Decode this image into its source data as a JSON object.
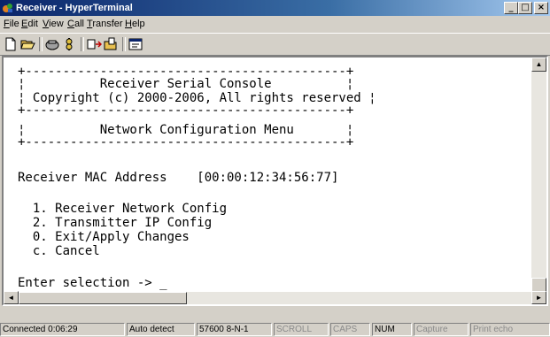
{
  "window": {
    "title": "Receiver - HyperTerminal"
  },
  "menu": {
    "items": [
      {
        "ul": "F",
        "rest": "ile"
      },
      {
        "ul": "E",
        "rest": "dit"
      },
      {
        "ul": "V",
        "rest": "iew"
      },
      {
        "ul": "C",
        "rest": "all"
      },
      {
        "ul": "T",
        "rest": "ransfer"
      },
      {
        "ul": "H",
        "rest": "elp"
      }
    ]
  },
  "toolbar": {
    "buttons": [
      "new-icon",
      "open-icon",
      "disconnect-icon",
      "connect-icon",
      "send-icon",
      "receive-icon",
      "properties-icon"
    ]
  },
  "terminal": {
    "lines": [
      "+-------------------------------------------+",
      "¦          Receiver Serial Console          ¦",
      "¦ Copyright (c) 2000-2006, All rights reserved ¦",
      "+-------------------------------------------+",
      "¦          Network Configuration Menu       ¦",
      "+-------------------------------------------+",
      "",
      "Receiver MAC Address    [00:00:12:34:56:77]",
      "",
      "  1. Receiver Network Config",
      "  2. Transmitter IP Config",
      "  0. Exit/Apply Changes",
      "  c. Cancel",
      "",
      "Enter selection -> _"
    ]
  },
  "status": {
    "connected": "Connected 0:06:29",
    "detect": "Auto detect",
    "port": "57600 8-N-1",
    "scroll": "SCROLL",
    "caps": "CAPS",
    "num": "NUM",
    "capture": "Capture",
    "print": "Print echo"
  },
  "colors": {
    "titlebar_start": "#0a246a",
    "titlebar_end": "#a6caf0",
    "chrome": "#d4d0c8"
  }
}
